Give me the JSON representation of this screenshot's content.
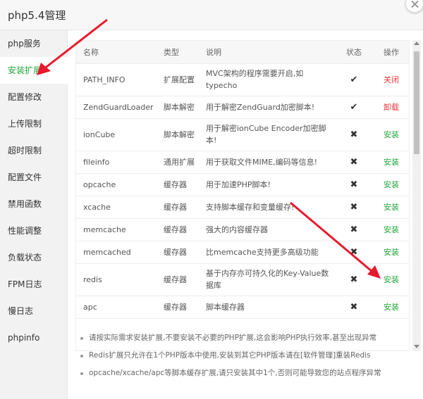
{
  "window": {
    "title": "php5.4管理"
  },
  "sidebar": {
    "items": [
      {
        "label": "php服务",
        "active": false
      },
      {
        "label": "安装扩展",
        "active": true
      },
      {
        "label": "配置修改",
        "active": false
      },
      {
        "label": "上传限制",
        "active": false
      },
      {
        "label": "超时限制",
        "active": false
      },
      {
        "label": "配置文件",
        "active": false
      },
      {
        "label": "禁用函数",
        "active": false
      },
      {
        "label": "性能调整",
        "active": false
      },
      {
        "label": "负载状态",
        "active": false
      },
      {
        "label": "FPM日志",
        "active": false
      },
      {
        "label": "慢日志",
        "active": false
      },
      {
        "label": "phpinfo",
        "active": false
      }
    ]
  },
  "table": {
    "headers": [
      "名称",
      "类型",
      "说明",
      "状态",
      "操作"
    ],
    "rows": [
      {
        "name": "PATH_INFO",
        "type": "扩展配置",
        "desc": "MVC架构的程序需要开启,如typecho",
        "installed": true,
        "action": "关闭",
        "action_color": "red"
      },
      {
        "name": "ZendGuardLoader",
        "type": "脚本解密",
        "desc": "用于解密ZendGuard加密脚本!",
        "installed": true,
        "action": "卸载",
        "action_color": "red"
      },
      {
        "name": "ionCube",
        "type": "脚本解密",
        "desc": "用于解密ionCube Encoder加密脚本!",
        "installed": false,
        "action": "安装",
        "action_color": "green"
      },
      {
        "name": "fileinfo",
        "type": "通用扩展",
        "desc": "用于获取文件MIME,编码等信息!",
        "installed": false,
        "action": "安装",
        "action_color": "green"
      },
      {
        "name": "opcache",
        "type": "缓存器",
        "desc": "用于加速PHP脚本!",
        "installed": false,
        "action": "安装",
        "action_color": "green"
      },
      {
        "name": "xcache",
        "type": "缓存器",
        "desc": "支持脚本缓存和变量缓存!",
        "installed": false,
        "action": "安装",
        "action_color": "green"
      },
      {
        "name": "memcache",
        "type": "缓存器",
        "desc": "强大的内容缓存器",
        "installed": false,
        "action": "安装",
        "action_color": "green"
      },
      {
        "name": "memcached",
        "type": "缓存器",
        "desc": "比memcache支持更多高级功能",
        "installed": false,
        "action": "安装",
        "action_color": "green"
      },
      {
        "name": "redis",
        "type": "缓存器",
        "desc": "基于内存亦可持久化的Key-Value数据库",
        "installed": false,
        "action": "安装",
        "action_color": "green"
      },
      {
        "name": "apc",
        "type": "缓存器",
        "desc": "脚本缓存器",
        "installed": false,
        "action": "安装",
        "action_color": "green"
      }
    ]
  },
  "notes": [
    "请按实际需求安装扩展,不要安装不必要的PHP扩展,这会影响PHP执行效率,甚至出现异常",
    "Redis扩展只允许在1个PHP版本中使用,安装到其它PHP版本请在[软件管理]重装Redis",
    "opcache/xcache/apc等脚本缓存扩展,请只安装其中1个,否则可能导致您的站点程序异常"
  ],
  "icons": {
    "installed": "check-icon",
    "not_installed": "cross-icon",
    "close": "close-icon"
  },
  "colors": {
    "accent_green": "#20a53a",
    "action_red": "#ee3333",
    "arrow_red": "#e8192c"
  }
}
